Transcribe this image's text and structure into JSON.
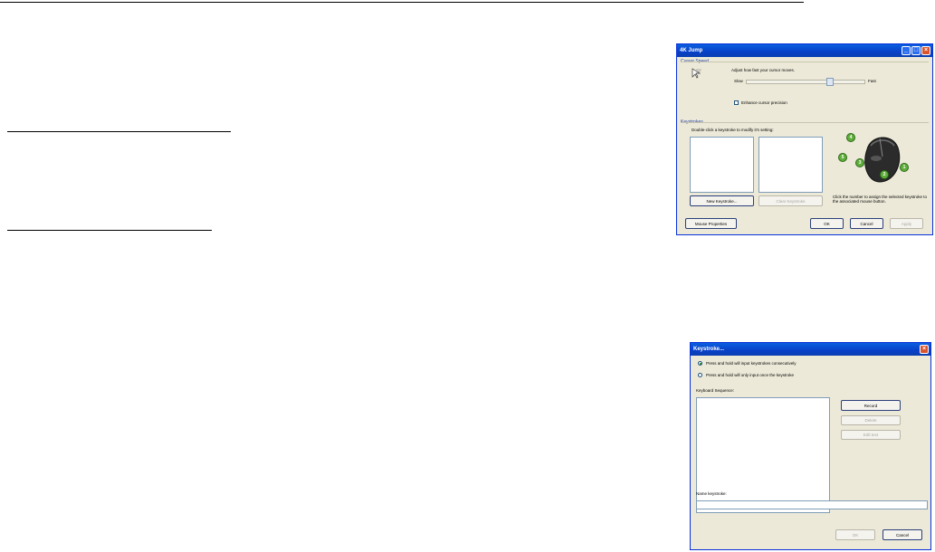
{
  "dialog1": {
    "title": "4K Jump",
    "cursor_speed": {
      "group_label": "Cursor Speed",
      "description": "Adjust how fast your cursor moves.",
      "slow_label": "Slow",
      "fast_label": "Fast",
      "speed_level": 0.72,
      "enhance_label": "Enhance cursor precision"
    },
    "keystrokes": {
      "group_label": "Keystrokes",
      "instruction": "Double-click a keystroke to modify it's setting:",
      "new_button": "New Keystroke...",
      "clear_button": "Clear Keystroke",
      "hint": "Click the number to assign the selected keystroke to the associated mouse button.",
      "badges": [
        "4",
        "5",
        "3",
        "2",
        "1"
      ]
    },
    "footer": {
      "mouse_properties": "Mouse Properties",
      "ok": "OK",
      "cancel": "Cancel",
      "apply": "Apply"
    }
  },
  "dialog2": {
    "title": "Keystroke...",
    "option_consecutive": "Press and hold will input keystrokes consecutively",
    "option_once": "Press and hold will only input once the keystroke",
    "sequence_label": "Keyboard Sequence:",
    "record_button": "Record",
    "delete_button": "Delete",
    "edit_button": "Edit text",
    "name_label": "Name keystroke:",
    "ok": "OK",
    "cancel": "Cancel"
  },
  "colors": {
    "xp_title": "#0a5fde",
    "dialog_bg": "#ece9d8",
    "badge_green": "#5fae3a"
  }
}
